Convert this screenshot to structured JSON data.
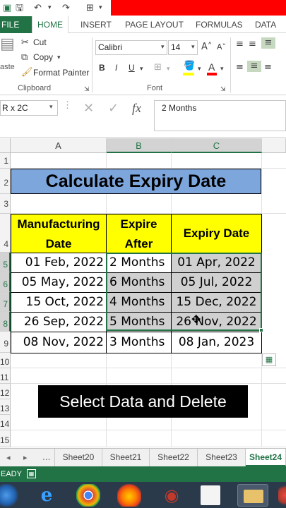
{
  "ribbon_tabs": [
    "FILE",
    "HOME",
    "INSERT",
    "PAGE LAYOUT",
    "FORMULAS",
    "DATA"
  ],
  "clipboard": {
    "paste_label": "aste",
    "cut_label": "Cut",
    "copy_label": "Copy",
    "format_painter_label": "Format Painter",
    "group_label": "Clipboard"
  },
  "font": {
    "name": "Calibri",
    "size": "14",
    "group_label": "Font",
    "bold": "B",
    "italic": "I",
    "underline": "U"
  },
  "formula_bar": {
    "name_box": "R x 2C",
    "fx": "fx",
    "content": "2 Months"
  },
  "columns": [
    "A",
    "B",
    "C"
  ],
  "rows": [
    "1",
    "2",
    "3",
    "4",
    "5",
    "6",
    "7",
    "8",
    "9",
    "10",
    "11",
    "12",
    "13",
    "14",
    "15"
  ],
  "sheet": {
    "title": "Calculate Expiry Date",
    "headers": {
      "a_line1": "Manufacturing",
      "a_line2": "Date",
      "b_line1": "Expire",
      "b_line2": "After",
      "c": "Expiry Date"
    },
    "data_rows": [
      {
        "mfg": "01 Feb, 2022",
        "after": "2 Months",
        "expiry": "01 Apr, 2022"
      },
      {
        "mfg": "05 May, 2022",
        "after": "6 Months",
        "expiry": "05 Jul, 2022"
      },
      {
        "mfg": "15 Oct, 2022",
        "after": "4 Months",
        "expiry": "15 Dec, 2022"
      },
      {
        "mfg": "26 Sep, 2022",
        "after": "5 Months",
        "expiry": "26 Nov, 2022"
      },
      {
        "mfg": "08 Nov, 2022",
        "after": "3 Months",
        "expiry": "08 Jan, 2023"
      }
    ]
  },
  "caption": "Select Data and Delete",
  "sheet_tabs": {
    "ellipsis": "...",
    "names": [
      "Sheet20",
      "Sheet21",
      "Sheet22",
      "Sheet23",
      "Sheet24"
    ],
    "active": "Sheet24"
  },
  "status": {
    "mode": "EADY"
  },
  "colors": {
    "excel_green": "#217346",
    "title_fill": "#7da6dc",
    "header_fill": "#ffff00",
    "selection_shade": "#d0d0d0"
  }
}
